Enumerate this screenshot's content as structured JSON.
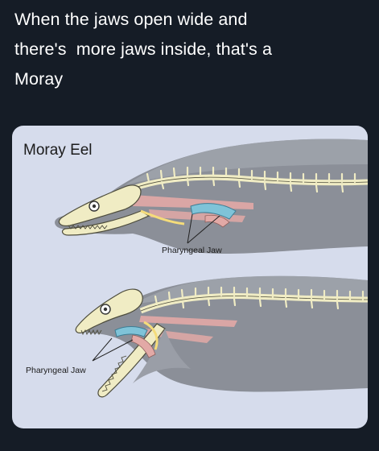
{
  "caption": {
    "lines": [
      "When the jaws open wide and",
      "there's  more jaws inside, that's a",
      "Moray"
    ]
  },
  "figure": {
    "title": "Moray Eel",
    "labels": {
      "top": "Pharyngeal Jaw",
      "bottom": "Pharyngeal Jaw"
    }
  },
  "colors": {
    "background": "#151c26",
    "card": "#d6dcec",
    "eel_body": "#8b8f98",
    "eel_highlight": "#a9adb5",
    "bone": "#f0ecc4",
    "bone_outline": "#4d4c3c",
    "muscle": "#e2a9a6",
    "pharyngeal": "#7fc3d8",
    "cartilage": "#f5dc7a"
  },
  "icons": [
    "eel-skeleton-illustration"
  ]
}
